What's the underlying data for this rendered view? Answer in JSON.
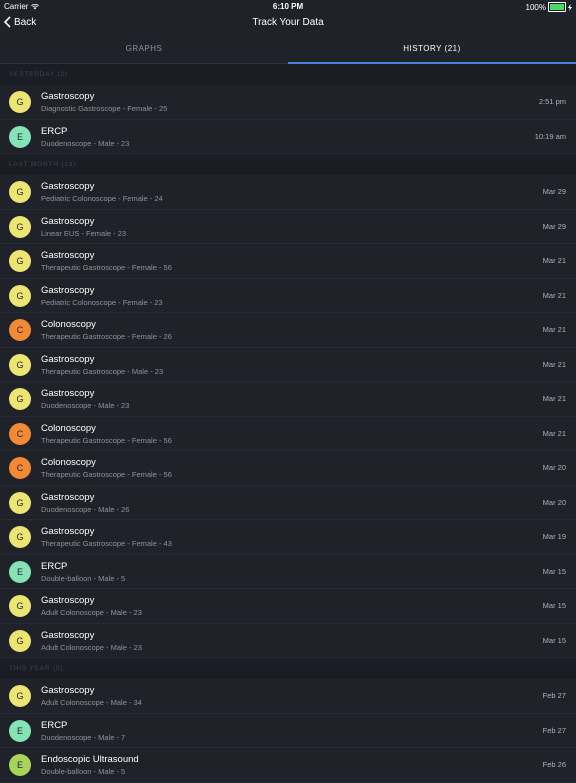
{
  "status": {
    "carrier": "Carrier",
    "time": "6:10 PM",
    "battery": "100%"
  },
  "nav": {
    "back_label": "Back",
    "title": "Track Your Data"
  },
  "tabs": [
    {
      "label": "GRAPHS",
      "active": false
    },
    {
      "label": "HISTORY (21)",
      "active": true
    }
  ],
  "colors": {
    "G": "#ece574",
    "E": "#86e3b6",
    "C": "#f28a35",
    "U": "#a9d45b",
    "accent": "#4a7fd8"
  },
  "sections": [
    {
      "header": "YESTERDAY (2)",
      "items": [
        {
          "letter": "G",
          "title": "Gastroscopy",
          "subtitle": "Diagnostic Gastroscope - Female - 25",
          "date": "2:51 pm"
        },
        {
          "letter": "E",
          "title": "ERCP",
          "subtitle": "Duodenoscope - Male - 23",
          "date": "10:19 am"
        }
      ]
    },
    {
      "header": "LAST MONTH (13)",
      "items": [
        {
          "letter": "G",
          "title": "Gastroscopy",
          "subtitle": "Pediatric Colonoscope - Female - 24",
          "date": "Mar 29"
        },
        {
          "letter": "G",
          "title": "Gastroscopy",
          "subtitle": "Linear EUS - Female - 23",
          "date": "Mar 29"
        },
        {
          "letter": "G",
          "title": "Gastroscopy",
          "subtitle": "Therapeutic Gastroscope - Female - 56",
          "date": "Mar 21"
        },
        {
          "letter": "G",
          "title": "Gastroscopy",
          "subtitle": "Pediatric Colonoscope - Female - 23",
          "date": "Mar 21"
        },
        {
          "letter": "C",
          "title": "Colonoscopy",
          "subtitle": "Therapeutic Gastroscope - Female - 26",
          "date": "Mar 21"
        },
        {
          "letter": "G",
          "title": "Gastroscopy",
          "subtitle": "Therapeutic Gastroscope - Male - 23",
          "date": "Mar 21"
        },
        {
          "letter": "G",
          "title": "Gastroscopy",
          "subtitle": "Duodenoscope - Male - 23",
          "date": "Mar 21"
        },
        {
          "letter": "C",
          "title": "Colonoscopy",
          "subtitle": "Therapeutic Gastroscope - Female - 56",
          "date": "Mar 21"
        },
        {
          "letter": "C",
          "title": "Colonoscopy",
          "subtitle": "Therapeutic Gastroscope - Female - 56",
          "date": "Mar 20"
        },
        {
          "letter": "G",
          "title": "Gastroscopy",
          "subtitle": "Duodenoscope - Male - 26",
          "date": "Mar 20"
        },
        {
          "letter": "G",
          "title": "Gastroscopy",
          "subtitle": "Therapeutic Gastroscope - Female - 43",
          "date": "Mar 19"
        },
        {
          "letter": "E",
          "title": "ERCP",
          "subtitle": "Double-balloon - Male - 5",
          "date": "Mar 15"
        },
        {
          "letter": "G",
          "title": "Gastroscopy",
          "subtitle": "Adult Colonoscope - Male - 23",
          "date": "Mar 15"
        },
        {
          "letter": "G",
          "title": "Gastroscopy",
          "subtitle": "Adult Colonoscope - Male - 23",
          "date": "Mar 15"
        }
      ]
    },
    {
      "header": "THIS YEAR (5)",
      "items": [
        {
          "letter": "G",
          "title": "Gastroscopy",
          "subtitle": "Adult Colonoscope - Male - 34",
          "date": "Feb 27"
        },
        {
          "letter": "E",
          "title": "ERCP",
          "subtitle": "Duodenoscope - Male - 7",
          "date": "Feb 27"
        },
        {
          "letter": "E",
          "title": "Endoscopic Ultrasound",
          "subtitle": "Double-balloon - Male - 5",
          "date": "Feb 26",
          "color_key": "U"
        }
      ]
    }
  ]
}
